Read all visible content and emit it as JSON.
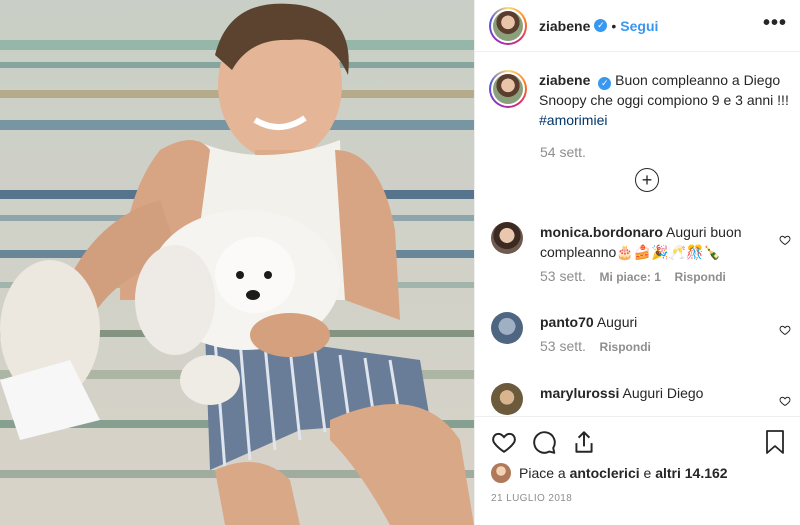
{
  "header": {
    "username": "ziabene",
    "separator": "•",
    "follow_label": "Segui",
    "more_label": "•••"
  },
  "caption": {
    "username": "ziabene",
    "text": "Buon compleanno a Diego Snoopy che oggi compiono 9 e 3 anni !!!",
    "hashtag": "#amorimiei",
    "time": "54 sett."
  },
  "load_more_label": "+",
  "comments": [
    {
      "username": "monica.bordonaro",
      "text": "Auguri buon compleanno🎂🍰🎉🥂🎊🍾",
      "time": "53 sett.",
      "likes": "Mi piace: 1",
      "reply": "Rispondi"
    },
    {
      "username": "panto70",
      "text": "Auguri",
      "time": "53 sett.",
      "reply": "Rispondi"
    },
    {
      "username": "marylurossi",
      "text": "Auguri Diego"
    }
  ],
  "footer": {
    "likes_prefix": "Piace a",
    "likes_user": "antoclerici",
    "likes_middle": "e",
    "likes_count": "altri 14.162",
    "date": "21 LUGLIO 2018"
  },
  "icons": {
    "like": "heart-icon",
    "comment": "comment-icon",
    "share": "share-icon",
    "save": "bookmark-icon",
    "more": "more-icon"
  },
  "colors": {
    "link_blue": "#3897f0",
    "hashtag": "#003569",
    "muted": "#8e8e8e"
  }
}
